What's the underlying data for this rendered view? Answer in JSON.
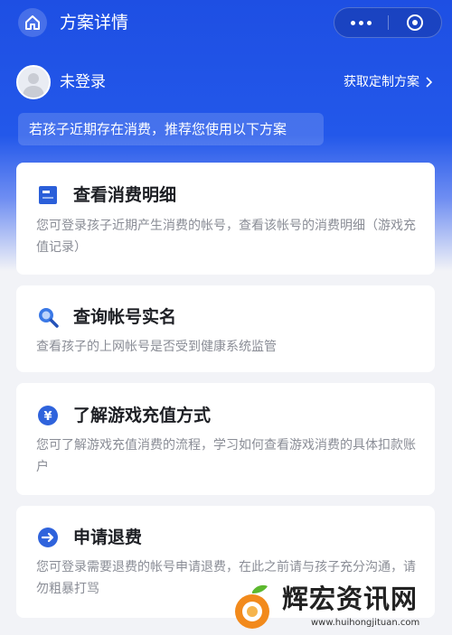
{
  "header": {
    "title": "方案详情",
    "home_icon": "home-icon",
    "more_icon": "more-dots-icon",
    "close_icon": "target-close-icon",
    "brand_color": "#2358ea"
  },
  "user": {
    "status": "未登录",
    "custom_plan_link": "获取定制方案"
  },
  "notice": "若孩子近期存在消费，推荐您使用以下方案",
  "cards": [
    {
      "icon": "bill-icon",
      "title": "查看消费明细",
      "desc": "您可登录孩子近期产生消费的帐号，查看该帐号的消费明细（游戏充值记录）"
    },
    {
      "icon": "search-icon",
      "title": "查询帐号实名",
      "desc": "查看孩子的上网帐号是否受到健康系统监管"
    },
    {
      "icon": "yuan-icon",
      "title": "了解游戏充值方式",
      "desc": "您可了解游戏充值消费的流程，学习如何查看游戏消费的具体扣款账户"
    },
    {
      "icon": "arrow-right-icon",
      "title": "申请退费",
      "desc": "您可登录需要退费的帐号申请退费，在此之前请与孩子充分沟通，请勿粗暴打骂"
    }
  ],
  "watermark": {
    "text": "辉宏资讯网",
    "url": "www.huihongjituan.com"
  }
}
